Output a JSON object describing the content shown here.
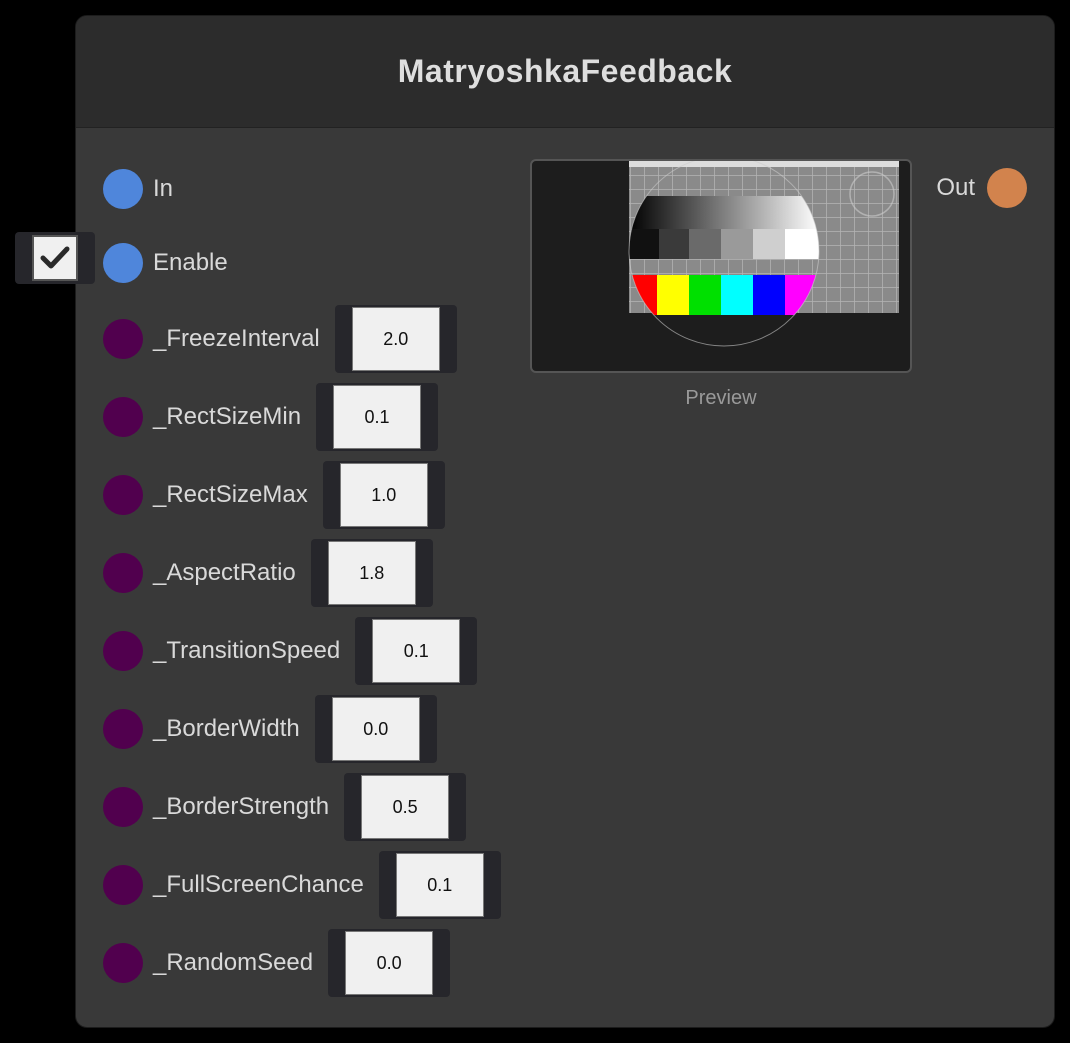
{
  "node": {
    "title": "MatryoshkaFeedback"
  },
  "inputs": {
    "in_label": "In",
    "enable_label": "Enable",
    "enable_checked": true
  },
  "params": [
    {
      "label": "_FreezeInterval",
      "value": "2.0"
    },
    {
      "label": "_RectSizeMin",
      "value": "0.1"
    },
    {
      "label": "_RectSizeMax",
      "value": "1.0"
    },
    {
      "label": "_AspectRatio",
      "value": "1.8"
    },
    {
      "label": "_TransitionSpeed",
      "value": "0.1"
    },
    {
      "label": "_BorderWidth",
      "value": "0.0"
    },
    {
      "label": "_BorderStrength",
      "value": "0.5"
    },
    {
      "label": "_FullScreenChance",
      "value": "0.1"
    },
    {
      "label": "_RandomSeed",
      "value": "0.0"
    }
  ],
  "preview": {
    "label": "Preview"
  },
  "outputs": {
    "out_label": "Out"
  },
  "colors": {
    "exec_port": "#4f86db",
    "param_port": "#51004e",
    "out_port": "#d2834d",
    "node_bg": "#393939",
    "header_bg": "#2c2c2c"
  },
  "icons": {
    "checkbox": "checkmark-icon"
  }
}
